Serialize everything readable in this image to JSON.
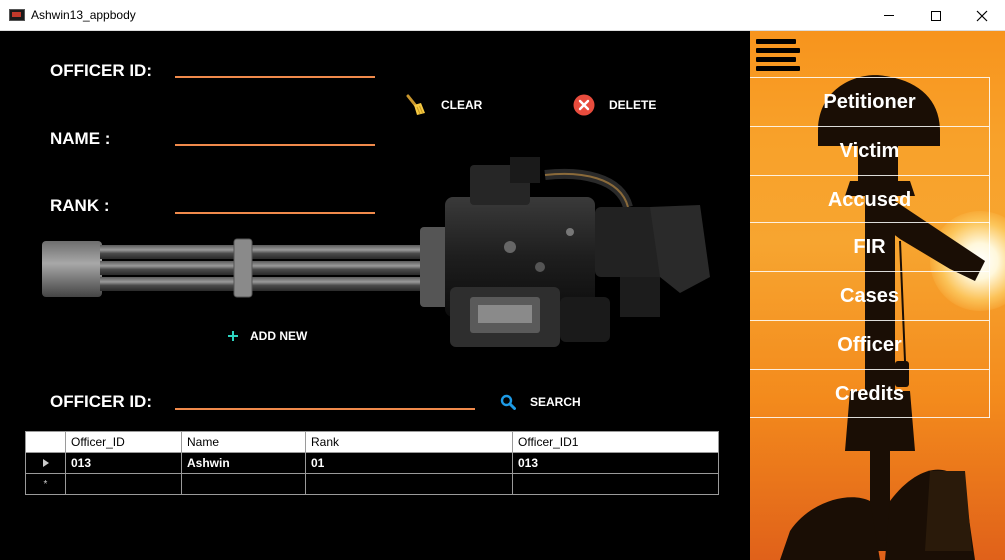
{
  "window": {
    "title": "Ashwin13_appbody",
    "minimize": "–",
    "maximize": "□",
    "close": "✕"
  },
  "form": {
    "officer_id_label": "OFFICER ID:",
    "name_label": "NAME :",
    "rank_label": "RANK :",
    "officer_id_value": "",
    "name_value": "",
    "rank_value": ""
  },
  "actions": {
    "clear_label": "CLEAR",
    "delete_label": "DELETE",
    "add_new_label": "ADD NEW",
    "search_label": "SEARCH"
  },
  "search": {
    "label": "OFFICER ID:",
    "value": ""
  },
  "grid": {
    "columns": [
      "Officer_ID",
      "Name",
      "Rank",
      "Officer_ID1"
    ],
    "rows": [
      [
        "013",
        "Ashwin",
        "01",
        "013"
      ]
    ],
    "current_row_marker": "▶",
    "new_row_marker": "*"
  },
  "sidebar": {
    "items": [
      {
        "label": "Petitioner"
      },
      {
        "label": "Victim"
      },
      {
        "label": "Accused"
      },
      {
        "label": "FIR"
      },
      {
        "label": "Cases"
      },
      {
        "label": "Officer"
      },
      {
        "label": "Credits"
      }
    ]
  },
  "icons": {
    "clear": "broom-icon",
    "delete": "delete-x-icon",
    "add_new": "plus-icon",
    "search": "magnifier-icon",
    "menu": "hamburger-icon"
  },
  "colors": {
    "accent_line": "#f08a4b",
    "delete_red": "#e84c3d",
    "plus_teal": "#2ed3c0",
    "search_blue": "#1e9be6",
    "sidebar_orange": "#f7941d"
  }
}
